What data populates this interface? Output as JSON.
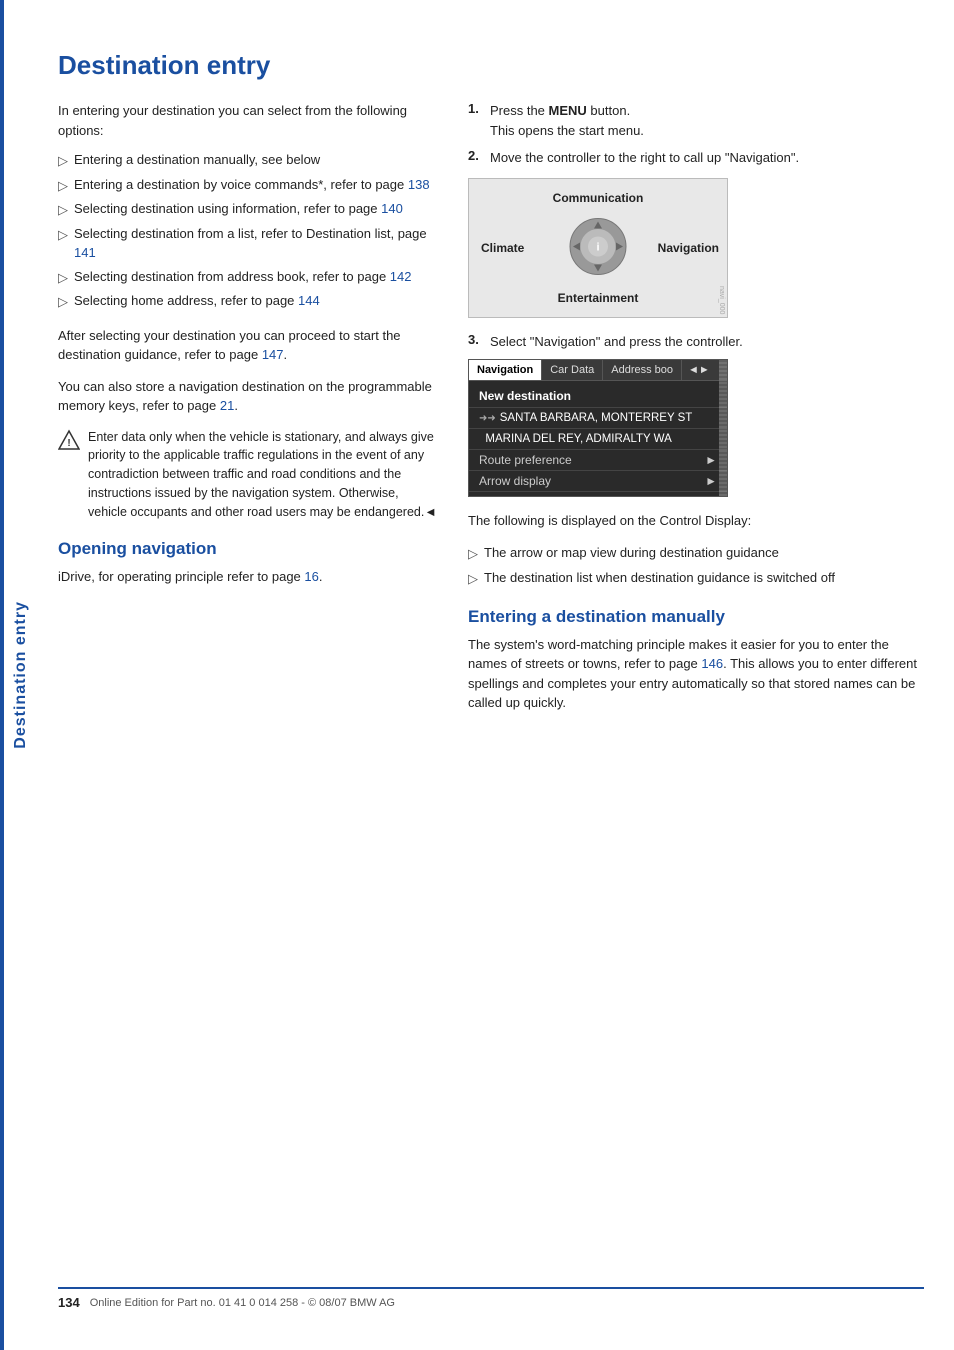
{
  "page": {
    "sidebar_label": "Destination entry",
    "title": "Destination entry",
    "intro": "In entering your destination you can select from the following options:",
    "bullets": [
      {
        "text": "Entering a destination manually, see below"
      },
      {
        "text": "Entering a destination by voice commands*, refer to page ",
        "link": "138"
      },
      {
        "text": "Selecting destination using information, refer to page ",
        "link": "140"
      },
      {
        "text": "Selecting destination from a list, refer to Destination list, page ",
        "link": "141"
      },
      {
        "text": "Selecting destination from address book, refer to page ",
        "link": "142"
      },
      {
        "text": "Selecting home address, refer to page ",
        "link": "144"
      }
    ],
    "after_select_text": "After selecting your destination you can proceed to start the destination guidance, refer to page ",
    "after_select_link": "147",
    "after_select_end": ".",
    "store_nav_text": "You can also store a navigation destination on the programmable memory keys, refer to page ",
    "store_nav_link": "21",
    "store_nav_end": ".",
    "warning_text": "Enter data only when the vehicle is stationary, and always give priority to the applicable traffic regulations in the event of any contradiction between traffic and road conditions and the instructions issued by the navigation system. Otherwise, vehicle occupants and other road users may be endangered.",
    "warning_end": "◄",
    "section_opening": {
      "title": "Opening navigation",
      "text": "iDrive, for operating principle refer to page ",
      "link": "16",
      "end": "."
    },
    "steps": [
      {
        "num": "1.",
        "text": "Press the ",
        "bold": "MENU",
        "text2": " button.",
        "sub": "This opens the start menu."
      },
      {
        "num": "2.",
        "text": "Move the controller to the right to call up \"Navigation\"."
      },
      {
        "num": "3.",
        "text": "Select \"Navigation\" and press the controller."
      }
    ],
    "nav_diagram": {
      "communication": "Communication",
      "climate": "Climate",
      "navigation": "Navigation",
      "entertainment": "Entertainment"
    },
    "nav_menu": {
      "tabs": [
        "Navigation",
        "Car Data",
        "Address boo",
        "◄►"
      ],
      "active_tab": "Navigation",
      "items": [
        {
          "type": "header",
          "text": "New destination"
        },
        {
          "type": "recent",
          "text": "➜➜SANTA BARBARA, MONTERREY ST"
        },
        {
          "type": "recent",
          "text": "MARINA DEL REY, ADMIRALTY WA"
        },
        {
          "type": "sub",
          "text": "Route preference",
          "arrow": "►"
        },
        {
          "type": "sub",
          "text": "Arrow display",
          "arrow": "►"
        }
      ]
    },
    "control_display_text": "The following is displayed on the Control Display:",
    "control_bullets": [
      "The arrow or map view during destination guidance",
      "The destination list when destination guidance is switched off"
    ],
    "section_entering": {
      "title": "Entering a destination manually",
      "text": "The system's word-matching principle makes it easier for you to enter the names of streets or towns, refer to page ",
      "link": "146",
      "end": ". This allows you to enter different spellings and completes your entry automatically so that stored names can be called up quickly."
    },
    "footer": {
      "page_number": "134",
      "text": "Online Edition for Part no. 01 41 0 014 258 - © 08/07 BMW AG"
    }
  }
}
